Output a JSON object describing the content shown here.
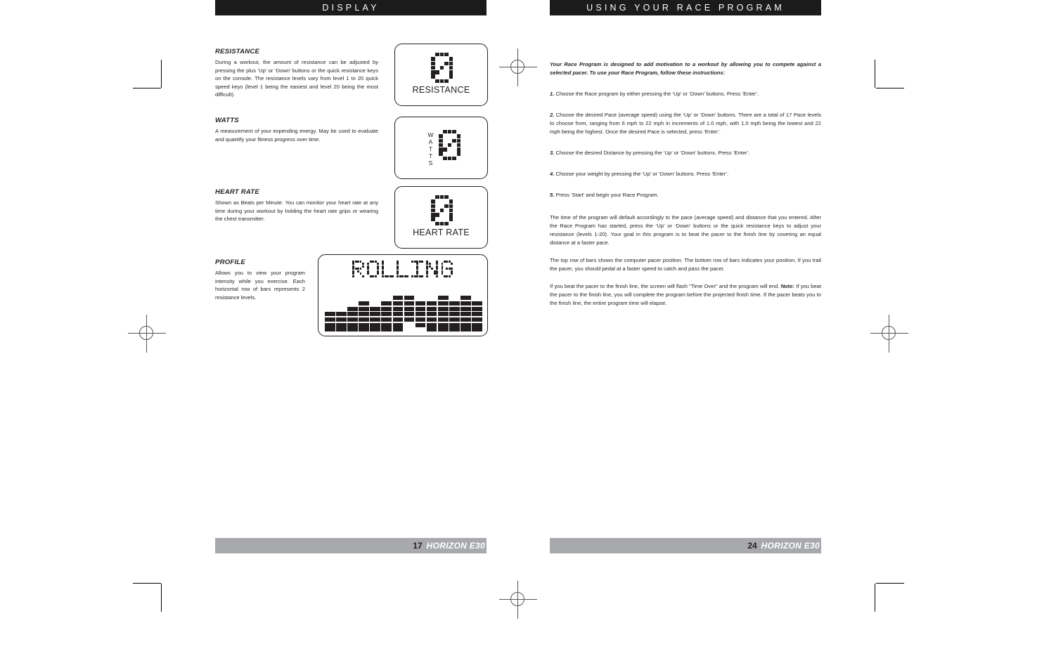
{
  "left_page": {
    "banner_title": "DISPLAY",
    "sections": [
      {
        "title": "RESISTANCE",
        "body": "During a workout, the amount of resistance can be adjusted by pressing the plus ‘Up’ or ‘Down’ buttons or the quick resistance keys on the console. The resistance levels vary from level 1 to 20 quick speed keys (level 1 being the easiest and level 20 being the most difficult)."
      },
      {
        "title": "WATTS",
        "body": "A measurement of your expending energy. May be used to evaluate and quantify your fitness progress over time."
      },
      {
        "title": "HEART RATE",
        "body": "Shown as Beats per Minute. You can monitor your heart rate at any time during your workout by holding the heart rate grips or wearing the chest transmitter."
      },
      {
        "title": "PROFILE",
        "body": "Allows you to view your program intensity while you exercise. Each horizontal row of bars represents 2 resistance levels."
      }
    ],
    "lcd_panels": {
      "resistance": {
        "label": "RESISTANCE",
        "value": "0"
      },
      "watts": {
        "label": "WATTS",
        "value": "0"
      },
      "heart_rate": {
        "label": "HEART RATE",
        "value": "0"
      },
      "profile": {
        "readout": "ROLLING"
      }
    },
    "footer": {
      "page_number": "17",
      "brand": "HORIZON E30"
    }
  },
  "right_page": {
    "banner_title": "USING YOUR RACE PROGRAM",
    "lead": "Your Race Program is designed to add motivation to a workout by allowing you to compete against a selected pacer. To use your Race Program, follow these instructions:",
    "steps": [
      {
        "n": "1.",
        "text": "Choose the Race program by either pressing the ‘Up’ or ‘Down’ buttons. Press ‘Enter’."
      },
      {
        "n": "2.",
        "text": "Choose the desired Pace (average speed) using the ‘Up’ or ‘Down’ buttons. There are a total of 17 Pace levels to choose from, ranging from 6 mph to 22 mph in increments of 1.0 mph, with 1.0 mph being the lowest and 22 mph being the highest. Once the desired Pace is selected, press ‘Enter’."
      },
      {
        "n": "3.",
        "text": "Choose the desired Distance by pressing the ‘Up’ or ‘Down’ buttons. Press ‘Enter’."
      },
      {
        "n": "4.",
        "text": "Choose your weight by pressing the ‘Up’ or ‘Down’ buttons. Press ‘Enter’."
      },
      {
        "n": "5.",
        "text": "Press ‘Start’ and begin your Race Program."
      }
    ],
    "paragraphs": [
      "The time of the program will default accordingly to the pace (average speed) and distance that you entered. After the Race Program has started, press the ‘Up’ or ‘Down’ buttons or the quick resistance keys to adjust your resistance (levels 1-20). Your goal in this program is to beat the pacer to the finish line by covering an equal distance at a faster pace.",
      "The top row of bars shows the computer pacer position. The bottom row of bars indicates your position. If you trail the pacer, you should pedal at a faster speed to catch and pass the pacer."
    ],
    "final_paragraph": {
      "line1": "If you beat the pacer to the finish line, the screen will flash “Time Over” and the program will end. ",
      "note_label": "Note:",
      "line2": " If you beat the pacer to the finish line, you will complete the program before the projected finish time. If the pacer beats you to the finish line, the entire program time will elapse."
    },
    "footer": {
      "page_number": "24",
      "brand": "HORIZON E30"
    }
  },
  "profile_chart": {
    "type": "bar",
    "title": "ROLLING",
    "columns": 14,
    "max_rows": 7,
    "values": [
      4,
      4,
      5,
      6,
      5,
      6,
      7,
      7,
      6,
      6,
      7,
      6,
      7,
      6
    ],
    "gaps": [
      {
        "column": 7,
        "missing_rows": [
          1,
          2
        ]
      },
      {
        "column": 8,
        "missing_rows": [
          1
        ]
      }
    ],
    "note": "Each horizontal row of bars represents 2 resistance levels."
  },
  "colors": {
    "ink": "#231f20",
    "banner_bg": "#1b1b1b",
    "banner_text": "#ffffff",
    "footer_bg": "#a7a9ac",
    "footer_brand": "#ffffff"
  }
}
